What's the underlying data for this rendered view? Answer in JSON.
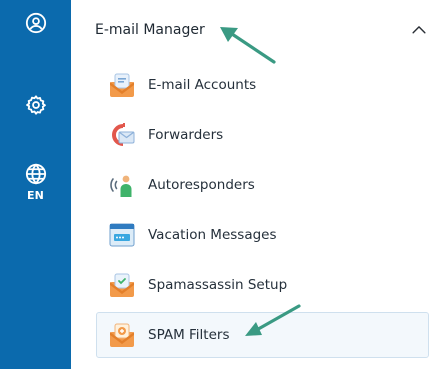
{
  "rail": {
    "items": [
      {
        "icon": "user-circle-icon"
      },
      {
        "icon": "gear-icon"
      },
      {
        "icon": "globe-icon",
        "label": "EN"
      }
    ],
    "color": "#0b6aad"
  },
  "section": {
    "title": "E-mail Manager",
    "expanded": true,
    "items": [
      {
        "label": "E-mail Accounts",
        "icon": "email-accounts-icon"
      },
      {
        "label": "Forwarders",
        "icon": "forwarders-icon"
      },
      {
        "label": "Autoresponders",
        "icon": "autoresponders-icon"
      },
      {
        "label": "Vacation Messages",
        "icon": "vacation-messages-icon"
      },
      {
        "label": "Spamassassin Setup",
        "icon": "spamassassin-icon"
      },
      {
        "label": "SPAM Filters",
        "icon": "spam-filters-icon",
        "active": true
      }
    ]
  },
  "annotation_color": "#3a9a83"
}
